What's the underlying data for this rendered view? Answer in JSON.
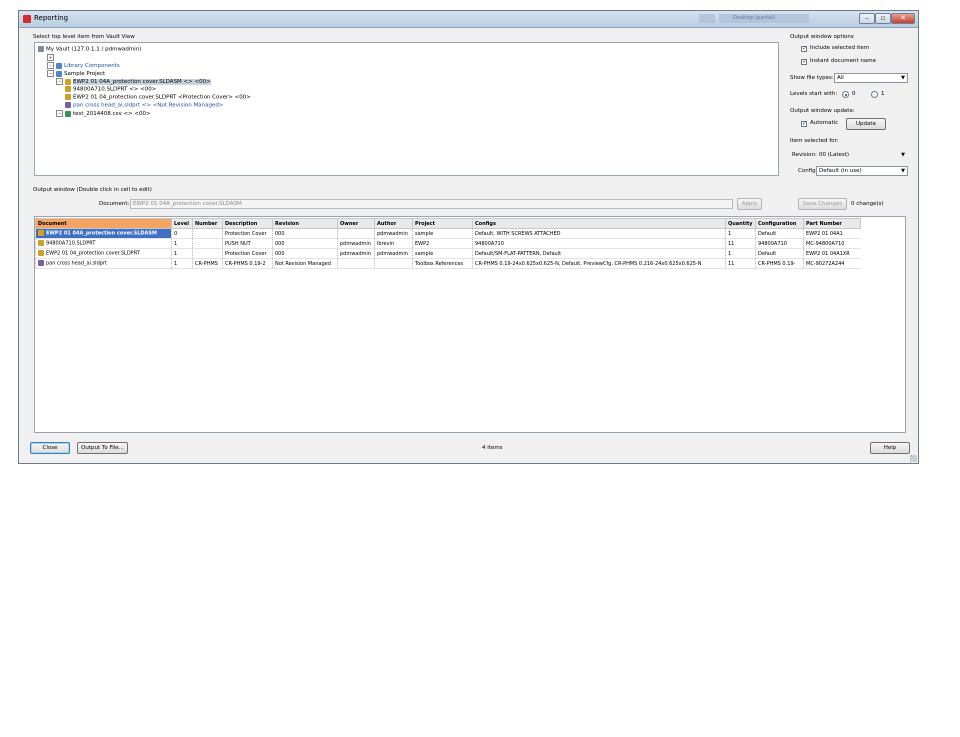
{
  "window": {
    "title": "Reporting",
    "ghost_text": "Desktop (partial)"
  },
  "tree": {
    "label": "Select top level item from Vault View",
    "nodes": [
      {
        "text": "My Vault (127.0.1.1 / pdmwadmin)",
        "icon": "vault-icon",
        "indent": 0,
        "style": "plain"
      },
      {
        "text": "",
        "icon": "",
        "indent": 1,
        "style": "plain"
      },
      {
        "text": "Library Components",
        "icon": "folder-icon",
        "indent": 1,
        "style": "link"
      },
      {
        "text": "Sample Project",
        "icon": "folder-icon",
        "indent": 1,
        "style": "plain"
      },
      {
        "text": "EWP2 01 04A_protection cover.SLDASM <> <00>",
        "icon": "assembly-icon",
        "indent": 2,
        "style": "selected"
      },
      {
        "text": "94800A710.SLDPRT <> <00>",
        "icon": "part-icon",
        "indent": 3,
        "style": "plain"
      },
      {
        "text": "EWP2 01 04_protection cover.SLDPRT <Protection Cover> <00>",
        "icon": "part-icon",
        "indent": 3,
        "style": "plain"
      },
      {
        "text": "pan cross head_ai.sldprt <> <Not Revision Managed>",
        "icon": "toolbox-part-icon",
        "indent": 3,
        "style": "link"
      },
      {
        "text": "test_2014408.csv <> <00>",
        "icon": "file-icon",
        "indent": 2,
        "style": "plain"
      }
    ]
  },
  "options": {
    "title": "Output window options",
    "include_selected": {
      "label": "Include selected item",
      "checked": true
    },
    "instant_name": {
      "label": "Instant document name",
      "checked": true
    },
    "show_file_types": {
      "label": "Show file types:",
      "value": "All"
    },
    "levels": {
      "label": "Levels start with:",
      "opt0": "0",
      "opt1": "1",
      "selected": "0"
    },
    "update": {
      "title": "Output window update:",
      "automatic": "Automatic",
      "automatic_checked": true,
      "button": "Update"
    },
    "item_selected": {
      "title": "Item selected for:",
      "revision_label": "Revision:",
      "revision_value": "00 (Latest)",
      "config_label": "Config:",
      "config_value": "Default (in use)"
    }
  },
  "output": {
    "label": "Output window (Double click in cell to edit)",
    "document_label": "Document:",
    "document_value": "EWP2 01 04A_protection cover.SLDASM",
    "apply": "Apply",
    "save_changes": "Save Changes",
    "changes": "0 change(s)"
  },
  "table": {
    "columns": [
      "Document",
      "Level",
      "Number",
      "Description",
      "Revision",
      "Owner",
      "Author",
      "Project",
      "Configs",
      "Quantity",
      "Configuration",
      "Part Number"
    ],
    "rows": [
      {
        "icon": "assembly-icon",
        "cells": [
          "EWP2 01 04A_protection cover.SLDASM",
          "0",
          "",
          "Protection Cover",
          "000",
          "",
          "pdmwadmin",
          "sample",
          "Default, WITH SCREWS ATTACHED",
          "1",
          "Default",
          "EWP2 01 04A1"
        ]
      },
      {
        "icon": "part-icon",
        "cells": [
          "94800A710.SLDPRT",
          "1",
          "",
          "PUSH NUT",
          "000",
          "pdmwadmin",
          "lbrevin",
          "EWP2",
          "94800A710",
          "11",
          "94800A710",
          "MC-94800A710"
        ]
      },
      {
        "icon": "part-icon",
        "cells": [
          "EWP2 01 04_protection cover.SLDPRT",
          "1",
          "",
          "Protection Cover",
          "000",
          "pdmwadmin",
          "pdmwadmin",
          "sample",
          "Default/SM-FLAT-PATTERN, Default",
          "1",
          "Default",
          "EWP2 01 04A1XR"
        ]
      },
      {
        "icon": "toolbox-part-icon",
        "cells": [
          "pan cross head_ai.sldprt",
          "1",
          "CR-PHMS",
          "CR-PHMS 0.19-2",
          "Not Revision Managed",
          "",
          "",
          "Toolbox References",
          "CR-PHMS 0.19-24x0.625x0.625-N, Default, PreviewCfg, CR-PHMS 0.216-24x0.625x0.625-N",
          "11",
          "CR-PHMS 0.19-",
          "MC-90272A244"
        ]
      }
    ]
  },
  "footer": {
    "close": "Close",
    "output_to_file": "Output To File...",
    "items_count": "4 items",
    "help": "Help"
  },
  "colors": {
    "sorted_header": "#f4a460",
    "selection": "#3d6fc6",
    "link": "#1f4fa8"
  }
}
